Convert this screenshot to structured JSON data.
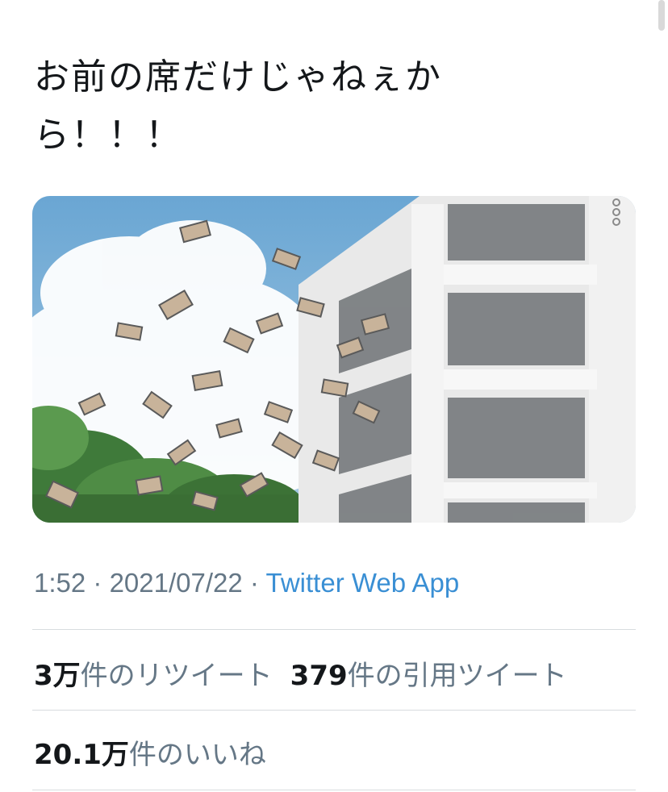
{
  "tweet": {
    "text": "お前の席だけじゃねぇか\nら！！！",
    "media": {
      "alt_icon": "more-options-icon"
    },
    "time": "1:52",
    "date": "2021/07/22",
    "separator": "·",
    "source": "Twitter Web App"
  },
  "stats": {
    "retweets_count": "3万",
    "retweets_label": "件のリツイート",
    "quotes_count": "379",
    "quotes_label": "件の引用ツイート",
    "likes_count": "20.1万",
    "likes_label": "件のいいね"
  },
  "colors": {
    "link": "#3a8fd4",
    "muted": "#657786",
    "text": "#14171a"
  }
}
